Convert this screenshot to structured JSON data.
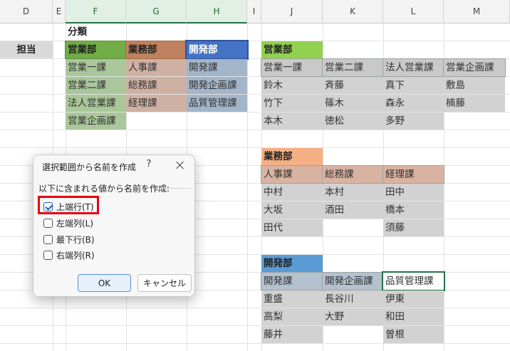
{
  "columns": [
    "D",
    "E",
    "F",
    "G",
    "H",
    "I",
    "J",
    "K",
    "L",
    "M"
  ],
  "row_label": "担当",
  "category_label": "分類",
  "left_table": {
    "headers": [
      "営業部",
      "業務部",
      "開発部"
    ],
    "header_colors": [
      "#70ad47",
      "#c0825e",
      "#4472c4"
    ],
    "body_colors": [
      "#a9c79a",
      "#cfb1a3",
      "#a3b5c9"
    ],
    "sales": [
      "営業一課",
      "営業二課",
      "法人営業課",
      "営業企画課"
    ],
    "business": [
      "人事課",
      "総務課",
      "経理課"
    ],
    "dev": [
      "開発課",
      "開発企画課",
      "品質管理課"
    ]
  },
  "right_blocks": {
    "sales": {
      "title": "営業部",
      "title_color": "#92d050",
      "heads": [
        "営業一課",
        "営業二課",
        "法人営業課",
        "営業企画課"
      ],
      "cols": [
        [
          "鈴木",
          "竹下",
          "本木"
        ],
        [
          "斉藤",
          "篠木",
          "徳松"
        ],
        [
          "真下",
          "森永",
          "多野"
        ],
        [
          "敷島",
          "楠藤"
        ]
      ]
    },
    "business": {
      "title": "業務部",
      "title_color": "#f4b084",
      "heads": [
        "人事課",
        "総務課",
        "経理課"
      ],
      "cols": [
        [
          "中村",
          "大坂",
          "田代"
        ],
        [
          "本村",
          "酒田"
        ],
        [
          "田中",
          "橋本",
          "須藤"
        ]
      ]
    },
    "dev": {
      "title": "開発部",
      "title_color": "#5b9bd5",
      "heads": [
        "開発課",
        "開発企画課",
        "品質管理課"
      ],
      "cols": [
        [
          "重盛",
          "高梨",
          "藤井"
        ],
        [
          "長谷川",
          "大野"
        ],
        [
          "伊東",
          "和田",
          "曽根"
        ]
      ]
    }
  },
  "dialog": {
    "title": "選択範囲から名前を作成",
    "help": "?",
    "group_label": "以下に含まれる値から名前を作成:",
    "options": [
      {
        "label": "上端行(T)",
        "checked": true
      },
      {
        "label": "左端列(L)",
        "checked": false
      },
      {
        "label": "最下行(B)",
        "checked": false
      },
      {
        "label": "右端列(R)",
        "checked": false
      }
    ],
    "ok_label": "OK",
    "cancel_label": "キャンセル"
  }
}
